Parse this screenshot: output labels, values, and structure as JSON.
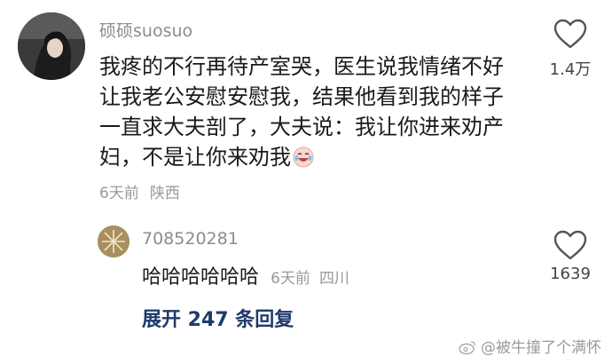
{
  "comment": {
    "username": "硕硕suosuo",
    "text": "我疼的不行再待产室哭，医生说我情绪不好让我老公安慰安慰我，结果他看到我的样子一直求大夫剖了，大夫说：我让你进来劝产妇，不是让你来劝我",
    "emoji_icon": "crying-laughing-face-icon",
    "time": "6天前",
    "location": "陕西",
    "likes": "1.4万"
  },
  "reply": {
    "username": "708520281",
    "text": "哈哈哈哈哈哈",
    "time": "6天前",
    "location": "四川",
    "likes": "1639"
  },
  "expand_label": "展开 247 条回复",
  "watermark": "@被牛撞了个满怀",
  "colors": {
    "username": "#8c8c8c",
    "meta": "#9a9a9a",
    "expand_link": "#1f3a6b",
    "text": "#1a1a1a"
  }
}
